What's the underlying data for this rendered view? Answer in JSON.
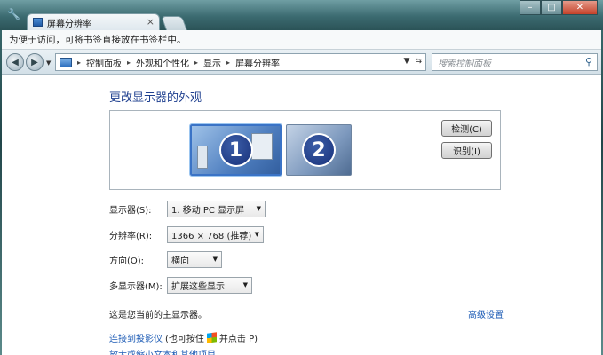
{
  "browser": {
    "tab_title": "屏幕分辨率",
    "infobar_text": "为便于访问，可将书签直接放在书签栏中。"
  },
  "nav": {
    "breadcrumb": [
      "控制面板",
      "外观和个性化",
      "显示",
      "屏幕分辨率"
    ],
    "search_placeholder": "搜索控制面板"
  },
  "page": {
    "title": "更改显示器的外观",
    "monitor1_number": "1",
    "monitor2_number": "2",
    "detect_label": "检测(C)",
    "identify_label": "识别(I)",
    "display_label": "显示器(S):",
    "display_value": "1. 移动 PC 显示屏",
    "resolution_label": "分辨率(R):",
    "resolution_value": "1366 × 768 (推荐)",
    "orientation_label": "方向(O):",
    "orientation_value": "横向",
    "multi_label": "多显示器(M):",
    "multi_value": "扩展这些显示",
    "main_note": "这是您当前的主显示器。",
    "advanced_link": "高级设置",
    "connect_link": "连接到投影仪",
    "connect_note_prefix": "(也可按住",
    "connect_note_suffix": "并点击 P)",
    "bottom_link": "放大或缩小文本和其他项目"
  },
  "icons": {
    "wrench": "wrench-icon",
    "search": "search-icon",
    "windows_key": "windows-logo-icon"
  }
}
